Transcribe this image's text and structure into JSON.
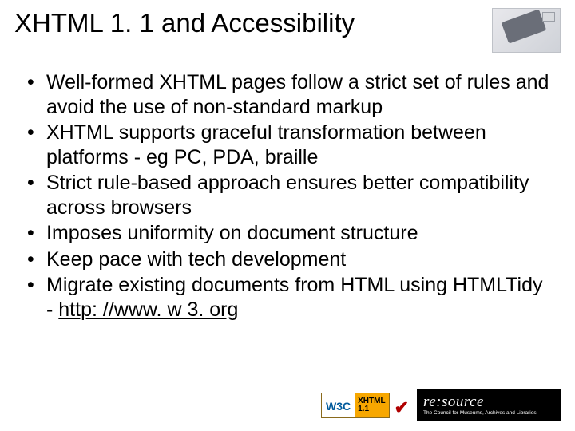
{
  "title": "XHTML 1. 1 and Accessibility",
  "bullets": [
    "Well-formed XHTML pages follow a strict set of rules and avoid the use of non-standard markup",
    "XHTML supports graceful transformation between platforms - eg PC, PDA, braille",
    "Strict rule-based approach ensures better compatibility across browsers",
    "Imposes uniformity on document structure",
    "Keep pace with tech development"
  ],
  "bullet_migrate_prefix": "Migrate existing documents from HTML using HTMLTidy - ",
  "bullet_migrate_link": "http: //www. w 3. org",
  "w3c": {
    "left": "W3C",
    "r1": "XHTML",
    "r2": "1.1"
  },
  "resource": {
    "name": "re:source",
    "sub": "The Council for Museums, Archives and Libraries"
  }
}
